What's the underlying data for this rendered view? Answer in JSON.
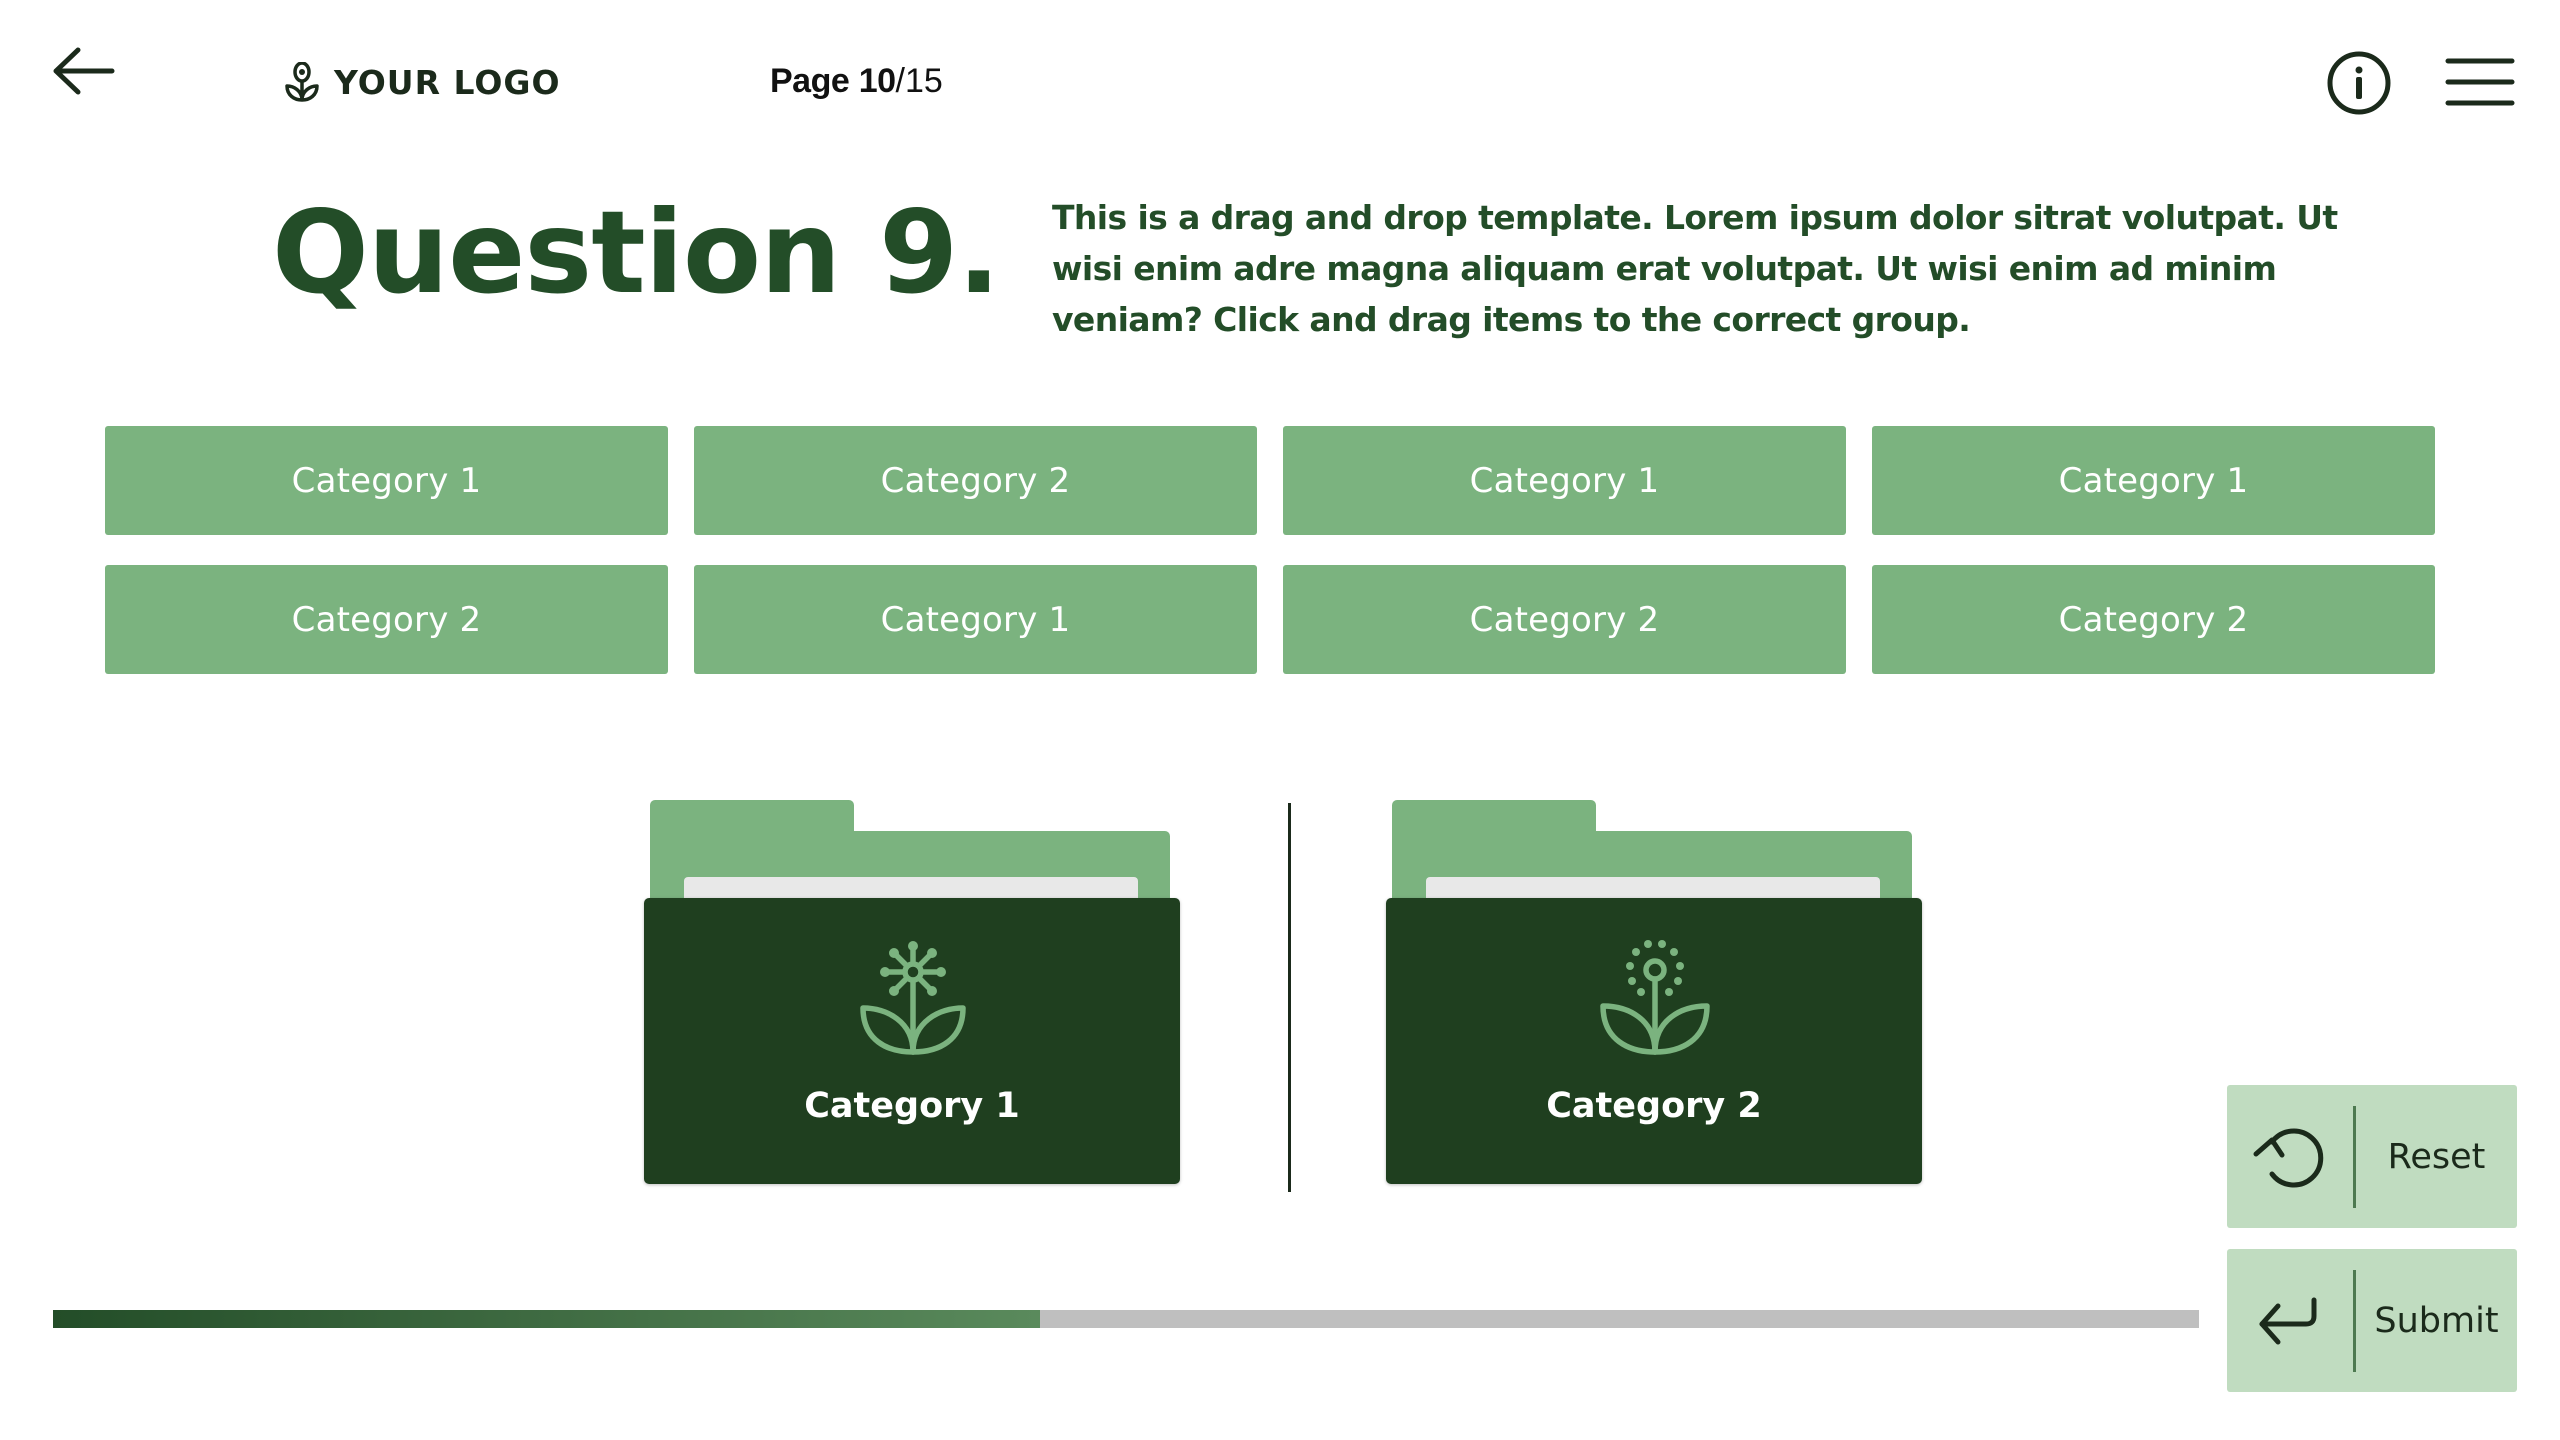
{
  "header": {
    "back_icon": "arrow-left-icon",
    "logo": {
      "icon": "flower-logo-icon",
      "text": "YOUR LOGO"
    },
    "page": {
      "label": "Page",
      "current": "10",
      "separator": "/",
      "total": "15"
    },
    "info_icon": "info-circle-icon",
    "menu_icon": "hamburger-menu-icon"
  },
  "question": {
    "title": "Question 9.",
    "description": "This is a drag and drop template. Lorem ipsum dolor sitrat volutpat. Ut wisi enim adre magna aliquam erat volutpat. Ut wisi enim ad minim veniam? Click and drag items to the correct group."
  },
  "items": [
    {
      "label": "Category 1"
    },
    {
      "label": "Category 2"
    },
    {
      "label": "Category 1"
    },
    {
      "label": "Category 1"
    },
    {
      "label": "Category 2"
    },
    {
      "label": "Category 1"
    },
    {
      "label": "Category 2"
    },
    {
      "label": "Category 2"
    }
  ],
  "drop_zones": [
    {
      "label": "Category 1",
      "icon": "flower-sprout-icon"
    },
    {
      "label": "Category 2",
      "icon": "dandelion-sprout-icon"
    }
  ],
  "actions": {
    "reset": {
      "label": "Reset",
      "icon": "reset-rotate-icon"
    },
    "submit": {
      "label": "Submit",
      "icon": "enter-return-icon"
    }
  },
  "progress": {
    "fraction": 0.46
  },
  "colors": {
    "primary_dark": "#234d28",
    "folder_dark": "#1f3f1f",
    "tile_green": "#7bb37f",
    "button_bg": "#c0dcc0",
    "progress_track": "#bfbfbf"
  }
}
